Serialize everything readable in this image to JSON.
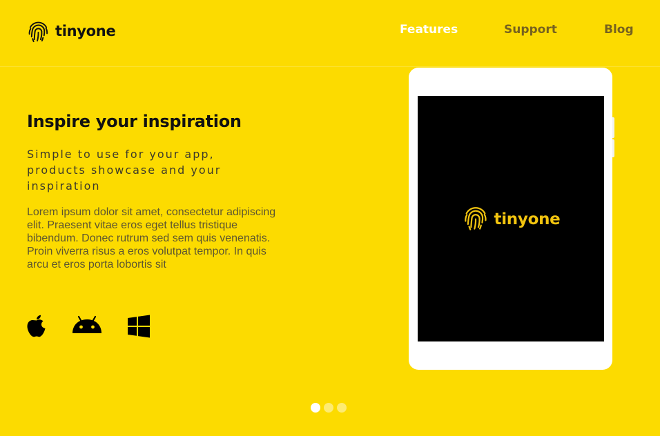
{
  "brand": {
    "name": "tinyone",
    "logo_icon": "fingerprint-icon"
  },
  "nav": {
    "items": [
      {
        "label": "Features",
        "active": true
      },
      {
        "label": "Support",
        "active": false
      },
      {
        "label": "Blog",
        "active": false
      }
    ]
  },
  "hero": {
    "title": "Inspire your inspiration",
    "subtitle": "Simple to use for your app, products showcase and your inspiration",
    "body": "Lorem ipsum dolor sit amet, consectetur adipiscing elit. Praesent vitae eros eget tellus tristique bibendum. Donec rutrum sed sem quis venenatis. Proin viverra risus a eros volutpat tempor. In quis arcu et eros porta lobortis sit",
    "platforms": [
      "apple-icon",
      "android-icon",
      "windows-icon"
    ]
  },
  "device": {
    "screen_brand": "tinyone",
    "screen_logo_icon": "fingerprint-icon"
  },
  "slider": {
    "slide_count": 3,
    "active_index": 0
  },
  "colors": {
    "background": "#FCDB00",
    "nav_active": "#FFFFFF",
    "nav_inactive": "#76621F",
    "screen_accent": "#F2C40F"
  }
}
